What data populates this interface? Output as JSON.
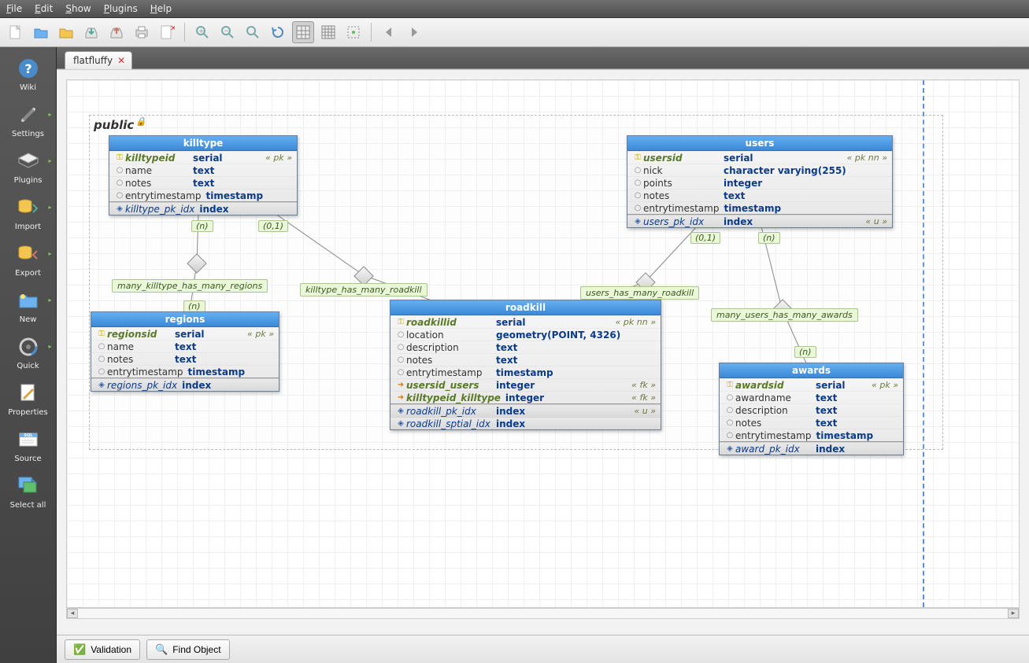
{
  "menubar": {
    "file": "File",
    "edit": "Edit",
    "show": "Show",
    "plugins": "Plugins",
    "help": "Help"
  },
  "sidebar": {
    "items": [
      {
        "label": "Wiki"
      },
      {
        "label": "Settings"
      },
      {
        "label": "Plugins"
      },
      {
        "label": "Import"
      },
      {
        "label": "Export"
      },
      {
        "label": "New"
      },
      {
        "label": "Quick"
      },
      {
        "label": "Properties"
      },
      {
        "label": "Source"
      },
      {
        "label": "Select all"
      }
    ]
  },
  "tab": {
    "name": "flatfluffy"
  },
  "schema": {
    "name": "public"
  },
  "relationships": {
    "r1": "many_killtype_has_many_regions",
    "r2": "killtype_has_many_roadkill",
    "r3": "users_has_many_roadkill",
    "r4": "many_users_has_many_awards"
  },
  "cardinalities": {
    "c1": "(n)",
    "c2": "(0,1)",
    "c3": "(n)",
    "c4": "(0,1)",
    "c5": "(n)",
    "c6": "(n)"
  },
  "tables": {
    "killtype": {
      "title": "killtype",
      "cols": [
        {
          "name": "killtypeid",
          "type": "serial",
          "kind": "pk",
          "const": "« pk »"
        },
        {
          "name": "name",
          "type": "text",
          "kind": "col"
        },
        {
          "name": "notes",
          "type": "text",
          "kind": "col"
        },
        {
          "name": "entrytimestamp",
          "type": "timestamp",
          "kind": "col"
        }
      ],
      "idx": [
        {
          "name": "killtype_pk_idx",
          "type": "index",
          "const": ""
        }
      ]
    },
    "regions": {
      "title": "regions",
      "cols": [
        {
          "name": "regionsid",
          "type": "serial",
          "kind": "pk",
          "const": "« pk »"
        },
        {
          "name": "name",
          "type": "text",
          "kind": "col"
        },
        {
          "name": "notes",
          "type": "text",
          "kind": "col"
        },
        {
          "name": "entrytimestamp",
          "type": "timestamp",
          "kind": "col"
        }
      ],
      "idx": [
        {
          "name": "regions_pk_idx",
          "type": "index",
          "const": ""
        }
      ]
    },
    "users": {
      "title": "users",
      "cols": [
        {
          "name": "usersid",
          "type": "serial",
          "kind": "pk",
          "const": "« pk nn »"
        },
        {
          "name": "nick",
          "type": "character varying(255)",
          "kind": "col"
        },
        {
          "name": "points",
          "type": "integer",
          "kind": "col"
        },
        {
          "name": "notes",
          "type": "text",
          "kind": "col"
        },
        {
          "name": "entrytimestamp",
          "type": "timestamp",
          "kind": "col"
        }
      ],
      "idx": [
        {
          "name": "users_pk_idx",
          "type": "index",
          "const": "« u »"
        }
      ]
    },
    "roadkill": {
      "title": "roadkill",
      "cols": [
        {
          "name": "roadkillid",
          "type": "serial",
          "kind": "pk",
          "const": "« pk nn »"
        },
        {
          "name": "location",
          "type": "geometry(POINT, 4326)",
          "kind": "col"
        },
        {
          "name": "description",
          "type": "text",
          "kind": "col"
        },
        {
          "name": "notes",
          "type": "text",
          "kind": "col"
        },
        {
          "name": "entrytimestamp",
          "type": "timestamp",
          "kind": "col"
        },
        {
          "name": "usersid_users",
          "type": "integer",
          "kind": "fk",
          "const": "« fk »"
        },
        {
          "name": "killtypeid_killtype",
          "type": "integer",
          "kind": "fk",
          "const": "« fk »"
        }
      ],
      "idx": [
        {
          "name": "roadkill_pk_idx",
          "type": "index",
          "const": "« u »"
        },
        {
          "name": "roadkill_sptial_idx",
          "type": "index",
          "const": ""
        }
      ]
    },
    "awards": {
      "title": "awards",
      "cols": [
        {
          "name": "awardsid",
          "type": "serial",
          "kind": "pk",
          "const": "« pk »"
        },
        {
          "name": "awardname",
          "type": "text",
          "kind": "col"
        },
        {
          "name": "description",
          "type": "text",
          "kind": "col"
        },
        {
          "name": "notes",
          "type": "text",
          "kind": "col"
        },
        {
          "name": "entrytimestamp",
          "type": "timestamp",
          "kind": "col"
        }
      ],
      "idx": [
        {
          "name": "award_pk_idx",
          "type": "index",
          "const": ""
        }
      ]
    }
  },
  "footer": {
    "validation": "Validation",
    "find": "Find Object"
  }
}
